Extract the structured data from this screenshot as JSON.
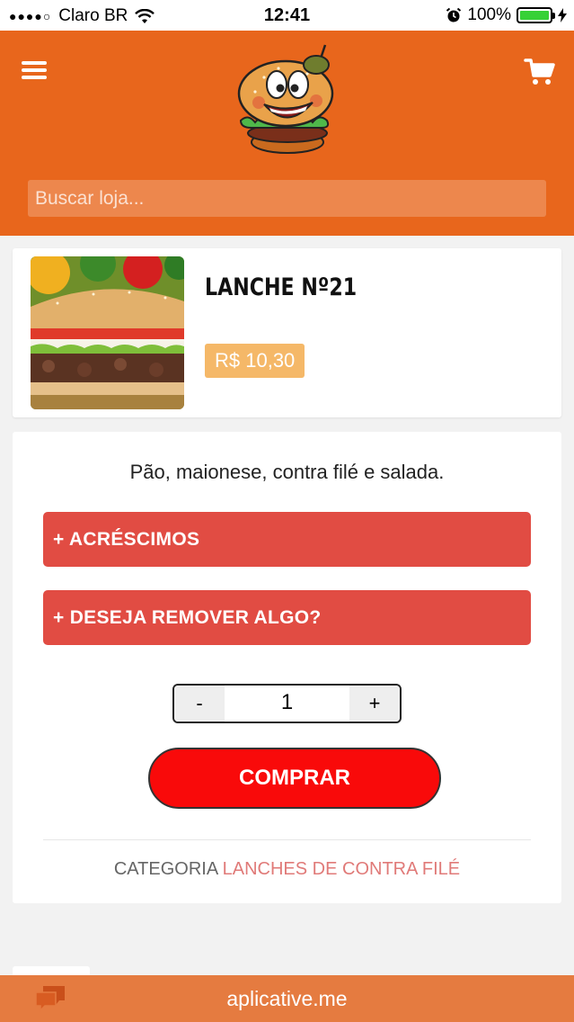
{
  "status_bar": {
    "carrier": "Claro BR",
    "signal_dots": "●●●●○",
    "time": "12:41",
    "battery": "100%"
  },
  "header": {
    "search_placeholder": "Buscar loja..."
  },
  "product": {
    "title": "LANCHE Nº21",
    "price": "R$ 10,30",
    "description": "Pão, maionese, contra filé e salada."
  },
  "options": {
    "acrescimos": "+ ACRÉSCIMOS",
    "remover": "+ DESEJA REMOVER ALGO?"
  },
  "quantity": {
    "minus": "-",
    "value": "1",
    "plus": "+"
  },
  "buy_label": "COMPRAR",
  "category": {
    "label": "CATEGORIA",
    "name": "LANCHES DE CONTRA FILÉ"
  },
  "footer": {
    "brand": "aplicative.me"
  },
  "colors": {
    "header_bg": "#e8661c",
    "option_button": "#e14c43",
    "buy_button": "#f90a0a",
    "price_badge": "#f5b868",
    "footer_bg": "#e57b40",
    "category_link": "#e07a78"
  },
  "icons": [
    "menu-icon",
    "cart-icon",
    "wifi-icon",
    "alarm-icon",
    "battery-icon",
    "chat-icon"
  ]
}
